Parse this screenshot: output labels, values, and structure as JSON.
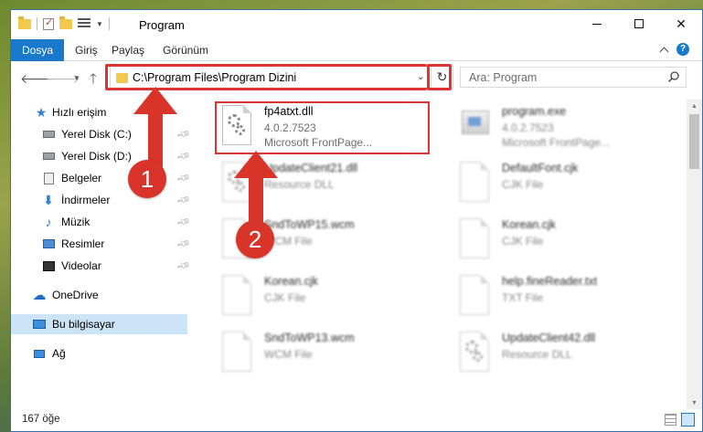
{
  "window": {
    "title": "Program"
  },
  "ribbon": {
    "tabs": [
      "Dosya",
      "Giriş",
      "Paylaş",
      "Görünüm"
    ],
    "help_label": "?"
  },
  "address": {
    "path": "C:\\Program Files\\Program Dizini"
  },
  "search": {
    "placeholder": "Ara: Program"
  },
  "sidebar": {
    "items": [
      {
        "label": "Hızlı erişim",
        "icon": "star-icon"
      },
      {
        "label": "Yerel Disk (C:)",
        "icon": "drive-icon",
        "pinned": true
      },
      {
        "label": "Yerel Disk (D:)",
        "icon": "drive-icon",
        "pinned": true
      },
      {
        "label": "Belgeler",
        "icon": "documents-icon",
        "pinned": true
      },
      {
        "label": "İndirmeler",
        "icon": "download-icon",
        "pinned": true
      },
      {
        "label": "Müzik",
        "icon": "music-icon",
        "pinned": true
      },
      {
        "label": "Resimler",
        "icon": "pictures-icon",
        "pinned": true
      },
      {
        "label": "Videolar",
        "icon": "video-icon",
        "pinned": true
      },
      {
        "label": "OneDrive",
        "icon": "cloud-icon"
      },
      {
        "label": "Bu bilgisayar",
        "icon": "computer-icon",
        "selected": true
      },
      {
        "label": "Ağ",
        "icon": "network-icon"
      }
    ]
  },
  "files": [
    {
      "name": "fp4atxt.dll",
      "line2": "4.0.2.7523",
      "line3": "Microsoft FrontPage...",
      "kind": "dll"
    },
    {
      "name": "program.exe",
      "line2": "4.0.2.7523",
      "line3": "Microsoft FrontPage...",
      "kind": "exe"
    },
    {
      "name": "UpdateClient21.dll",
      "line2": "Resource DLL",
      "kind": "dll"
    },
    {
      "name": "DefaultFont.cjk",
      "line2": "CJK File",
      "kind": "doc"
    },
    {
      "name": "SndToWP15.wcm",
      "line2": "WCM File",
      "kind": "doc"
    },
    {
      "name": "Korean.cjk",
      "line2": "CJK File",
      "kind": "doc"
    },
    {
      "name": "Korean.cjk",
      "line2": "CJK File",
      "kind": "doc"
    },
    {
      "name": "help.fineReader.txt",
      "line2": "TXT File",
      "kind": "doc"
    },
    {
      "name": "SndToWP13.wcm",
      "line2": "WCM File",
      "kind": "doc"
    },
    {
      "name": "UpdateClient42.dll",
      "line2": "Resource DLL",
      "kind": "dll"
    }
  ],
  "status": {
    "item_count": "167 öğe"
  },
  "annotations": {
    "step1": "1",
    "step2": "2"
  },
  "colors": {
    "accent": "#1979ca",
    "annotation": "#d8342a",
    "selection": "#cce4f7"
  }
}
